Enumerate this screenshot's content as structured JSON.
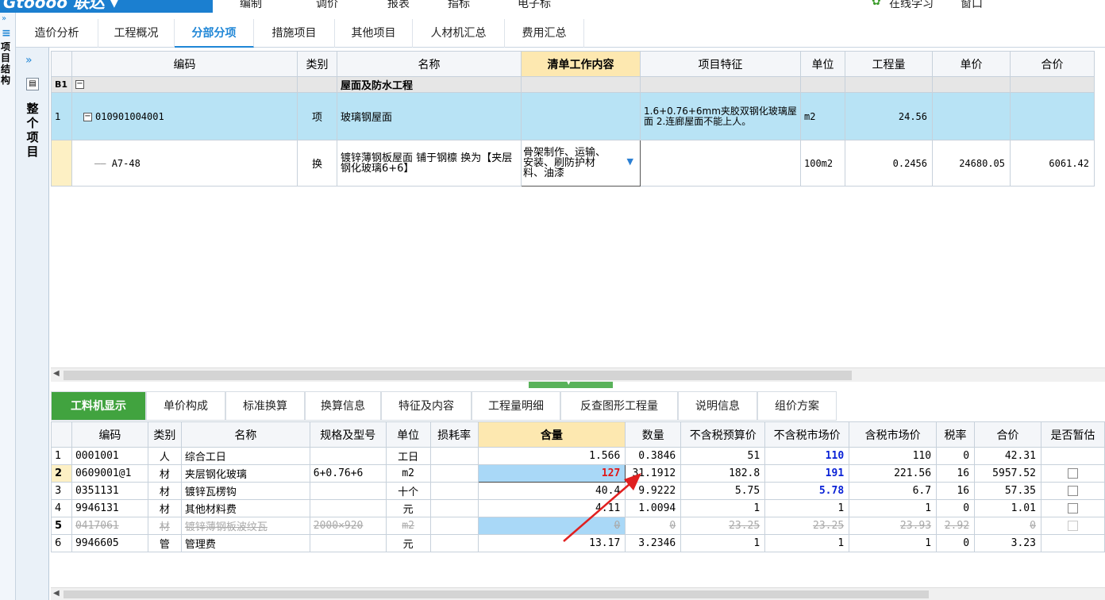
{
  "app": {
    "logo": "Gtoooo 联达 ▾",
    "menu": [
      "编制",
      "调价",
      "报表",
      "指标",
      "电子标"
    ],
    "right_menu": [
      "在线学习",
      "窗口"
    ]
  },
  "left_panel": {
    "label_side": "项目结构",
    "label_main": "整个项目"
  },
  "tabs": [
    "造价分析",
    "工程概况",
    "分部分项",
    "措施项目",
    "其他项目",
    "人材机汇总",
    "费用汇总"
  ],
  "grid1": {
    "headers": [
      "编码",
      "类别",
      "名称",
      "清单工作内容",
      "项目特征",
      "单位",
      "工程量",
      "单价",
      "合价"
    ],
    "rows": [
      {
        "no": "B1",
        "code": "",
        "type": "",
        "name": "屋面及防水工程",
        "content": "",
        "feature": "",
        "unit": "",
        "qty": "",
        "price": "",
        "total": ""
      },
      {
        "no": "1",
        "code": "010901004001",
        "type": "项",
        "name": "玻璃钢屋面",
        "content": "",
        "feature": "1.6+0.76+6mm夹胶双钢化玻璃屋面 2.连廊屋面不能上人。",
        "unit": "m2",
        "qty": "24.56",
        "price": "",
        "total": ""
      },
      {
        "no": "",
        "code": "A7-48",
        "type": "换",
        "name": "镀锌薄钢板屋面 铺于钢檩 换为【夹层钢化玻璃6+6】",
        "content": "骨架制作、运输、安装、刷防护材料、油漆",
        "feature": "",
        "unit": "100m2",
        "qty": "0.2456",
        "price": "24680.05",
        "total": "6061.42"
      }
    ]
  },
  "bottom_tabs": [
    "工料机显示",
    "单价构成",
    "标准换算",
    "换算信息",
    "特征及内容",
    "工程量明细",
    "反查图形工程量",
    "说明信息",
    "组价方案"
  ],
  "grid2": {
    "headers": [
      "编码",
      "类别",
      "名称",
      "规格及型号",
      "单位",
      "损耗率",
      "含量",
      "数量",
      "不含税预算价",
      "不含税市场价",
      "含税市场价",
      "税率",
      "合价",
      "是否暂估"
    ],
    "rows": [
      {
        "no": "1",
        "code": "0001001",
        "type": "人",
        "name": "综合工日",
        "spec": "",
        "unit": "工日",
        "loss": "",
        "content": "1.566",
        "qty": "0.3846",
        "budget": "51",
        "market": "110",
        "market_tax": "110",
        "tax": "0",
        "total": "42.31"
      },
      {
        "no": "2",
        "code": "0609001@1",
        "type": "材",
        "name": "夹层钢化玻璃",
        "spec": "6+0.76+6",
        "unit": "m2",
        "loss": "",
        "content": "127",
        "qty": "31.1912",
        "budget": "182.8",
        "market": "191",
        "market_tax": "221.56",
        "tax": "16",
        "total": "5957.52"
      },
      {
        "no": "3",
        "code": "0351131",
        "type": "材",
        "name": "镀锌瓦楞钩",
        "spec": "",
        "unit": "十个",
        "loss": "",
        "content": "40.4",
        "qty": "9.9222",
        "budget": "5.75",
        "market": "5.78",
        "market_tax": "6.7",
        "tax": "16",
        "total": "57.35"
      },
      {
        "no": "4",
        "code": "9946131",
        "type": "材",
        "name": "其他材料费",
        "spec": "",
        "unit": "元",
        "loss": "",
        "content": "4.11",
        "qty": "1.0094",
        "budget": "1",
        "market": "1",
        "market_tax": "1",
        "tax": "0",
        "total": "1.01"
      },
      {
        "no": "5",
        "code": "0417061",
        "type": "材",
        "name": "镀锌薄钢板波纹瓦",
        "spec": "2000×920",
        "unit": "m2",
        "loss": "",
        "content": "0",
        "qty": "0",
        "budget": "23.25",
        "market": "23.25",
        "market_tax": "23.93",
        "tax": "2.92",
        "total": "0"
      },
      {
        "no": "6",
        "code": "9946605",
        "type": "管",
        "name": "管理费",
        "spec": "",
        "unit": "元",
        "loss": "",
        "content": "13.17",
        "qty": "3.2346",
        "budget": "1",
        "market": "1",
        "market_tax": "1",
        "tax": "0",
        "total": "3.23"
      }
    ]
  },
  "colors": {
    "accent": "#1f86d6",
    "row_selected": "#b8e3f5",
    "tab_active": "#41a33f",
    "highlight_header": "#fde8b0",
    "arrow": "#e02020"
  }
}
